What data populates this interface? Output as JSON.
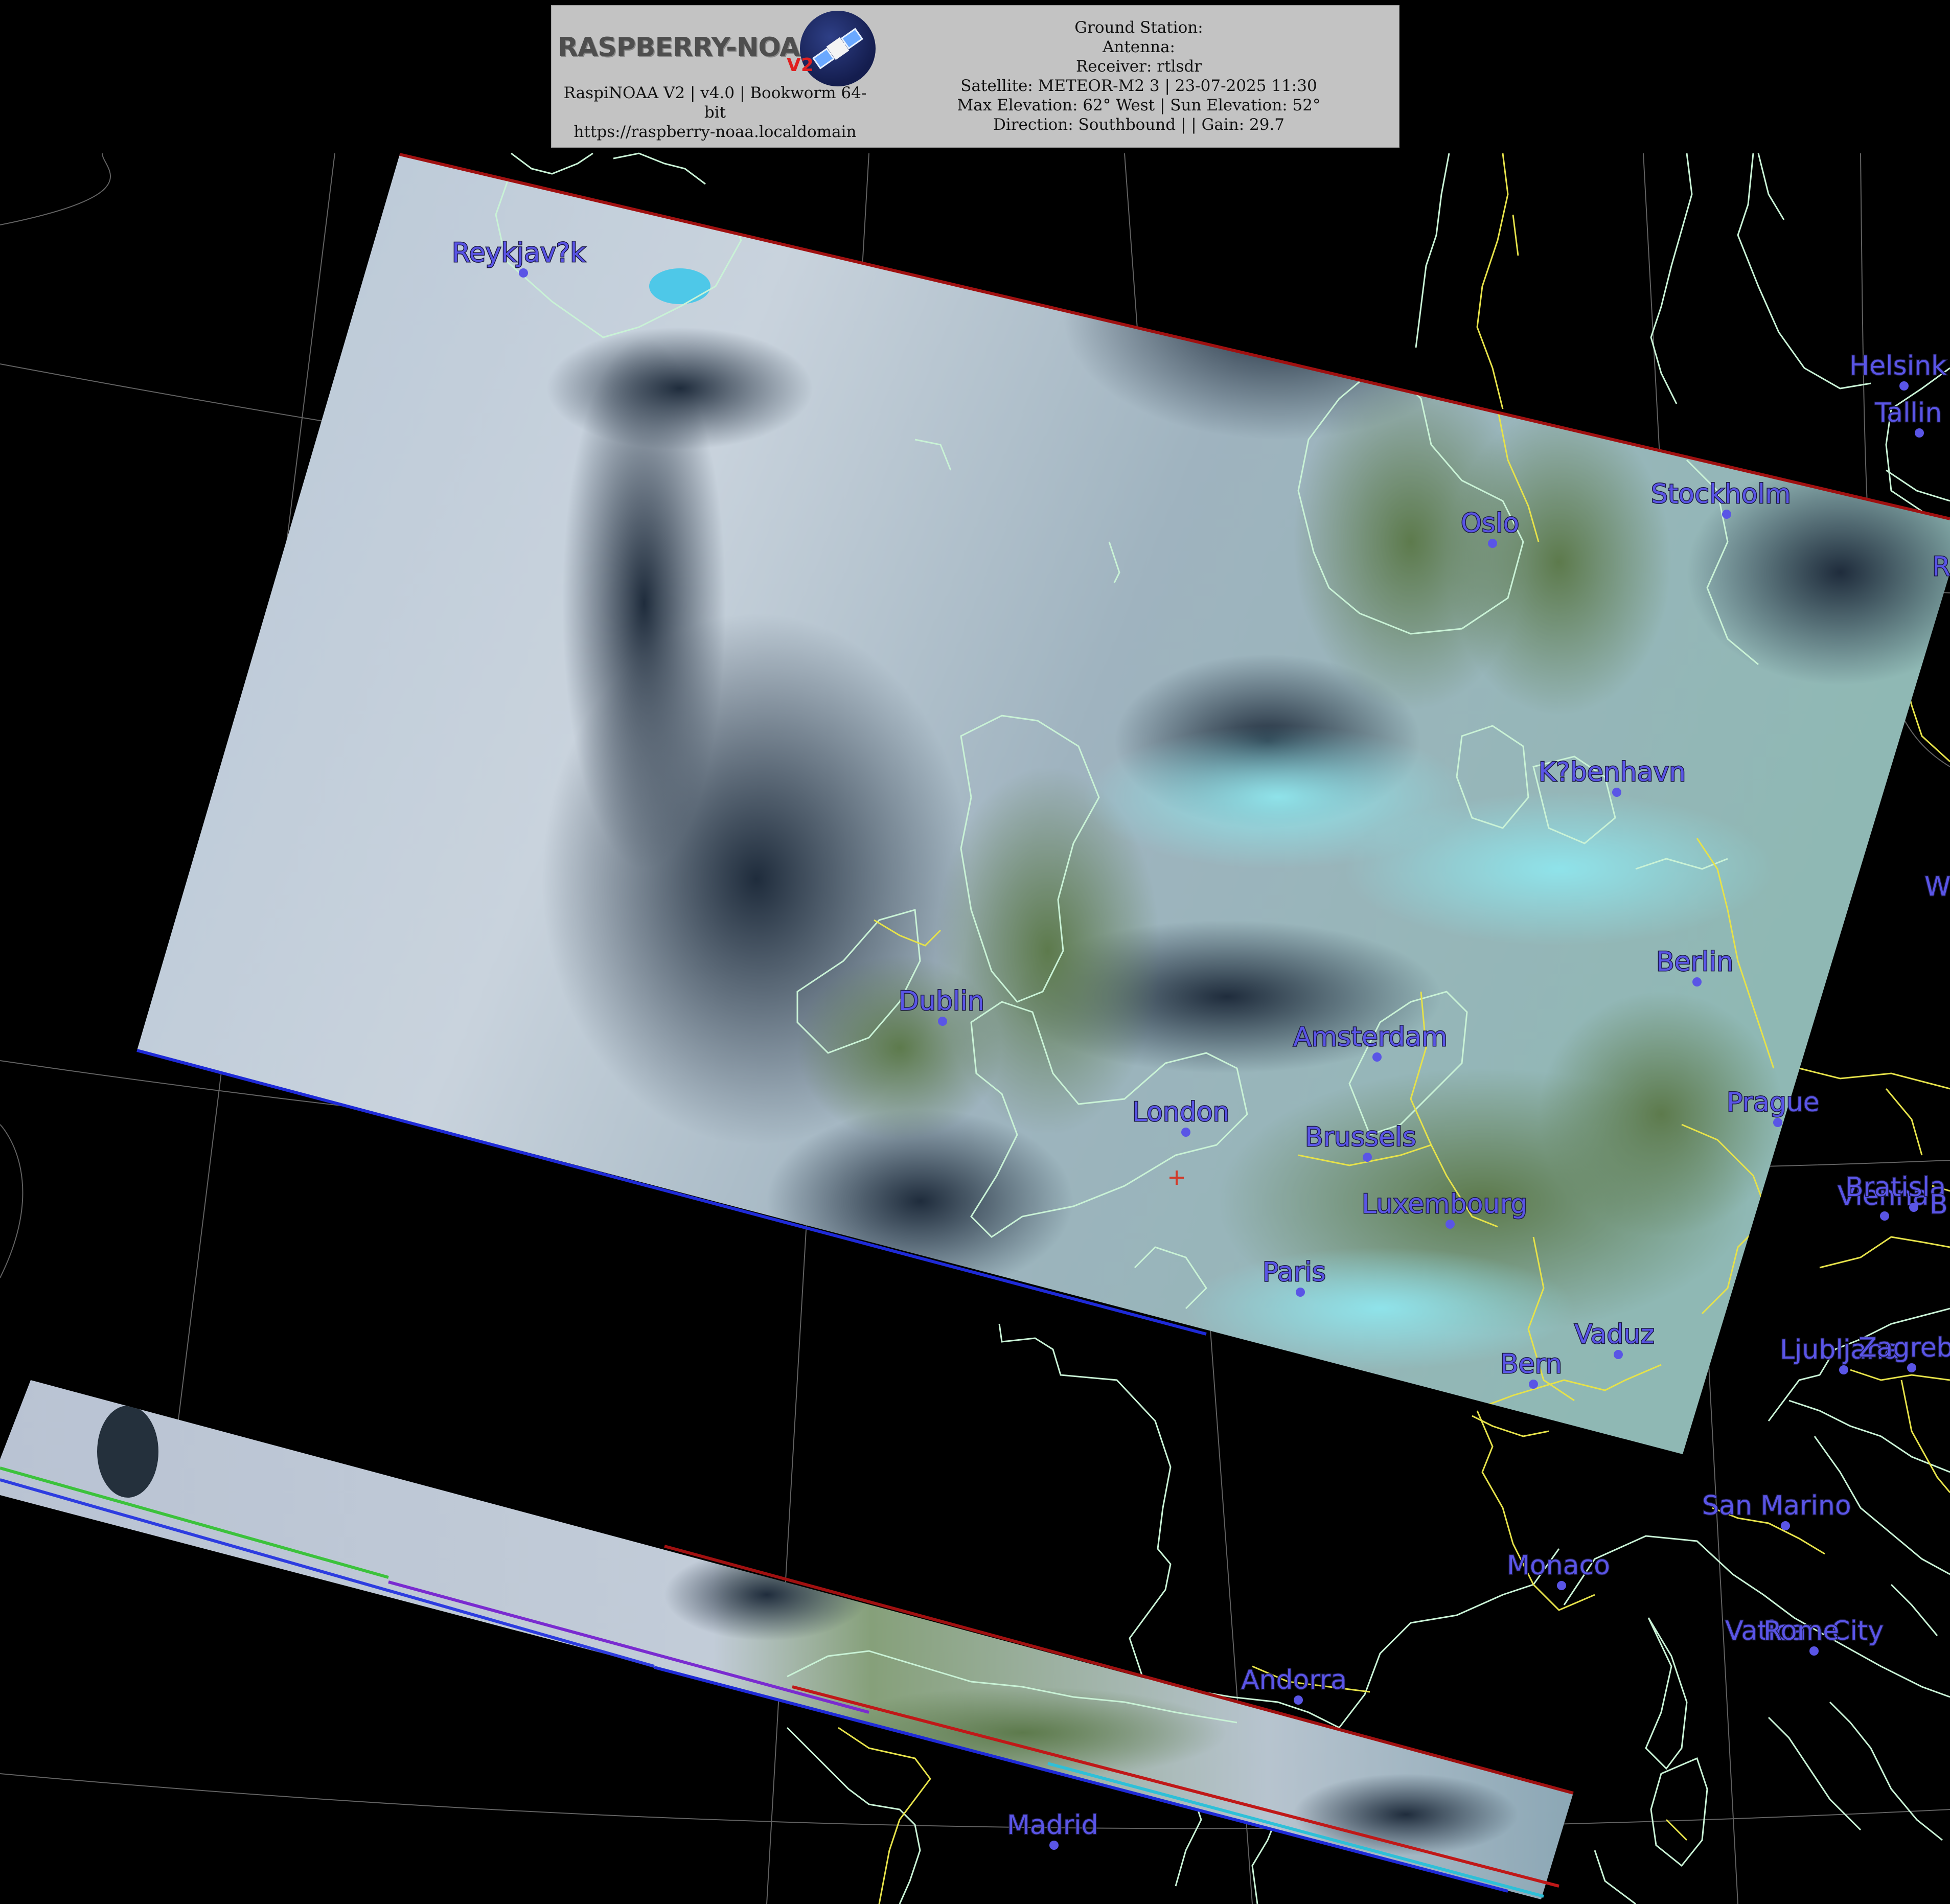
{
  "header": {
    "logo_text": "RASPBERRY-NOAA",
    "logo_badge_text": "V2",
    "software_line1": "RaspiNOAA V2 | v4.0 | Bookworm 64-",
    "software_line2": "bit",
    "software_url": "https://raspberry-noaa.localdomain",
    "ground_station": "Ground Station:",
    "antenna": "Antenna:",
    "receiver": "Receiver: rtlsdr",
    "satellite": "Satellite: METEOR-M2 3 | 23-07-2025 11:30",
    "elevation": "Max Elevation: 62° West | Sun Elevation: 52°",
    "direction": "Direction: Southbound | | Gain: 29.7"
  },
  "map": {
    "label_color": "#5a55e6",
    "coastline_color": "#c9f2d6",
    "border_color": "#e6e24a",
    "graticule_color": "#7a7a7a",
    "cities": {
      "reykjavik": "Reykjav?k",
      "helsinki": "Helsink",
      "tallinn": "Tallin",
      "stockholm": "Stockholm",
      "oslo": "Oslo",
      "kobenhavn": "K?benhavn",
      "berlin": "Berlin",
      "dublin": "Dublin",
      "amsterdam": "Amsterdam",
      "london": "London",
      "brussels": "Brussels",
      "prague": "Prague",
      "luxembourg": "Luxembourg",
      "vienna": "Vienna",
      "bratislava": "Bratisla",
      "paris": "Paris",
      "vaduz": "Vaduz",
      "bern": "Bern",
      "ljubljana": "Ljubljana",
      "zagreb": "Zagreb",
      "san_marino": "San Marino",
      "monaco": "Monaco",
      "vatican_city": "Vatican City",
      "rome": "Rome",
      "andorra": "Andorra",
      "madrid": "Madrid",
      "edge_w": "W",
      "edge_r": "R",
      "edge_b": "B"
    }
  }
}
